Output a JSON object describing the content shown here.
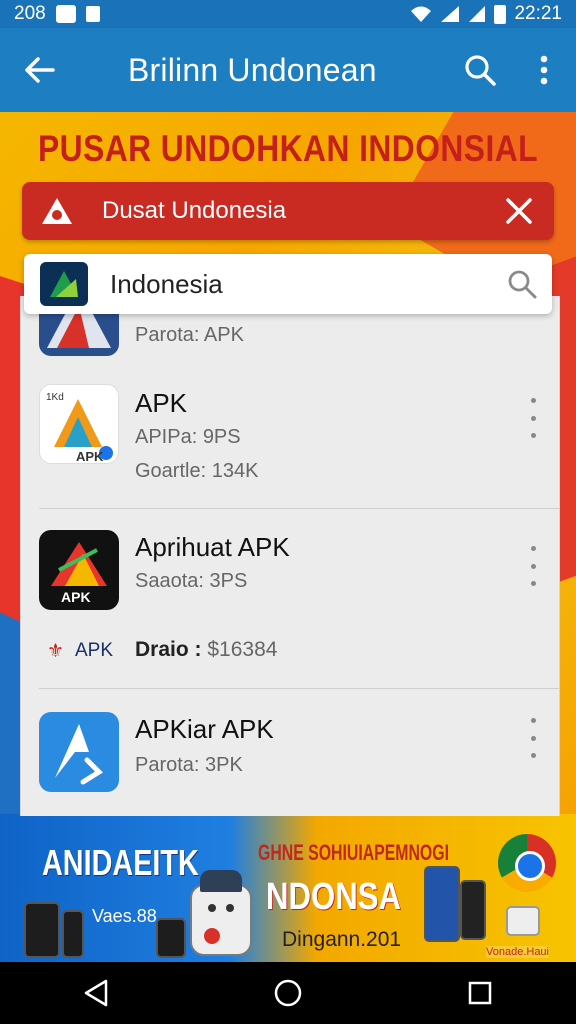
{
  "status_bar": {
    "time": "22:21",
    "left_text": "208"
  },
  "app_bar": {
    "title": "Brilinn Undonean"
  },
  "hero": {
    "heading": "PUSAR UNDOHKAN INDONSIAL",
    "banner_label": "Dusat Undonesia"
  },
  "search": {
    "value": "Indonesia"
  },
  "list": {
    "items": [
      {
        "name": "",
        "meta1": "Parota: APK",
        "meta2": ""
      },
      {
        "name": "APK",
        "meta1": "APIPa: 9PS",
        "meta2": "Goartle: 134K",
        "icon_text_top": "1Kd",
        "icon_text_bottom": "APK"
      },
      {
        "name": "Aprihuat APK",
        "meta1": "Saaota: 3PS",
        "icon_text": "APK"
      },
      {
        "name": "APKiar APK",
        "meta1": "Parota: 3PK"
      }
    ],
    "sub_row": {
      "label": "APK",
      "meta_label": "Draio :",
      "meta_value": "$16384"
    }
  },
  "ad": {
    "brand": "ANIDAEITK",
    "sub": "Vaes.88",
    "tag": "GHNE SOHIUIAPEMNOGI",
    "headline": "NDONSA",
    "footer": "Dingann.201",
    "corner": "Vonade.Haui"
  },
  "colors": {
    "app_bar": "#1d7fc1",
    "banner_red": "#c92b22",
    "heading_red": "#c41f1a",
    "hero_yellow": "#f5b700"
  },
  "icons": [
    "back-arrow-icon",
    "search-icon",
    "more-vert-icon",
    "warning-icon",
    "close-icon",
    "nav-back-icon",
    "nav-home-icon",
    "nav-recents-icon"
  ]
}
